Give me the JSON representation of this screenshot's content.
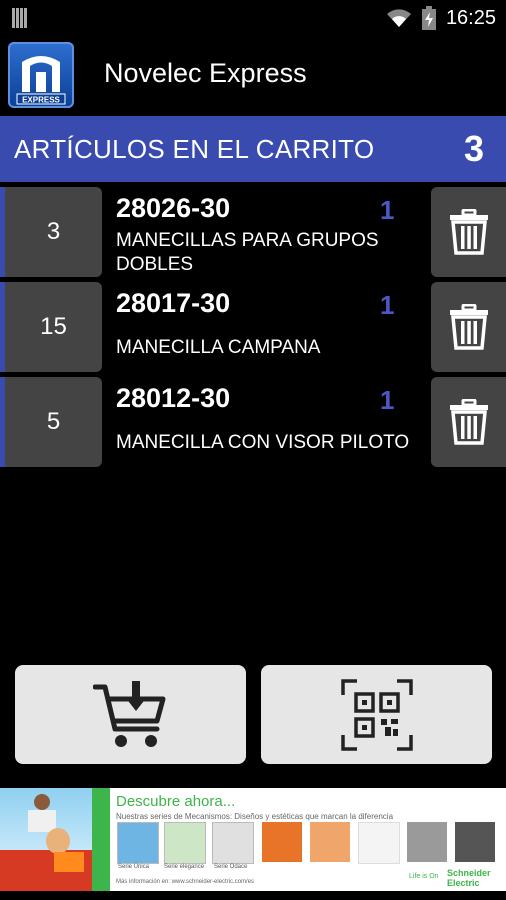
{
  "statusbar": {
    "time": "16:25",
    "wifi_icon": "wifi-icon",
    "battery_icon": "battery-charging-icon"
  },
  "app": {
    "title": "Novelec Express",
    "logo_text": "EXPRESS"
  },
  "cart": {
    "header_label": "ARTÍCULOS EN EL CARRITO",
    "item_count": "3",
    "items": [
      {
        "qty": "3",
        "code": "28026-30",
        "units": "1",
        "description": "MANECILLAS PARA GRUPOS DOBLES"
      },
      {
        "qty": "15",
        "code": "28017-30",
        "units": "1",
        "description": "MANECILLA CAMPANA"
      },
      {
        "qty": "5",
        "code": "28012-30",
        "units": "1",
        "description": "MANECILLA CON VISOR PILOTO"
      }
    ]
  },
  "actions": {
    "add_to_cart_icon": "cart-download-icon",
    "scan_icon": "qr-scan-icon"
  },
  "ad": {
    "headline": "Descubre ahora...",
    "subline": "Nuestras series de Mecanismos: Diseños y estéticas que marcan la diferencia",
    "swatches": [
      "Serie Única",
      "Serie elegance",
      "Serie Odace"
    ],
    "footer": "Más información en: www.schneider-electric.com/es",
    "tagline": "Life is On",
    "brand": "Schneider Electric"
  },
  "colors": {
    "accent": "#3a4bb0",
    "units_blue": "#4a59c6",
    "tile_gray": "#444444",
    "button_gray": "#e6e6e6",
    "ad_green": "#3db54a"
  }
}
